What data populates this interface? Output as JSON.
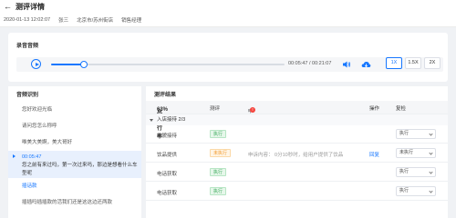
{
  "header": {
    "title": "测评详情"
  },
  "meta": {
    "datetime": "2020-01-13 12:02:07",
    "name": "张三",
    "location": "北京市/苏州街店",
    "role": "销售经理"
  },
  "audio": {
    "label": "录音音频",
    "current_time": "00:05:47",
    "separator": "/",
    "total_time": "00:21:07",
    "progress_fraction": 0.14,
    "speeds": [
      "1X",
      "1.5X",
      "2X"
    ],
    "active_speed": "1X"
  },
  "recognition": {
    "title": "音频识别",
    "items": [
      {
        "text": "您好欢迎光临",
        "active": false
      },
      {
        "text": "请问您怎么称呼",
        "active": false
      },
      {
        "text": "唯美大美婀，美大哥好",
        "active": false
      },
      {
        "timestamp": "00:05:47",
        "text": "您之前有来过吗，第一次过来吗，那边是想看什么车型呢",
        "active": true
      },
      {
        "text": "插话款",
        "active": false,
        "blue": true
      },
      {
        "text": "插插吗插插款的活我们还是这这边还两款",
        "active": false
      }
    ]
  },
  "results": {
    "title": "测评结果",
    "columns": {
      "rate_label": "总执行率",
      "rate_value": "63%",
      "review": "测评",
      "appeal": "申诉",
      "appeal_badge": "!",
      "op": "操作",
      "recheck": "复检"
    },
    "group": {
      "name": "入店接待",
      "progress": "2/3"
    },
    "rows": [
      {
        "item": "礼貌接待",
        "tag": "执行",
        "tag_color": "green",
        "appeal": "",
        "op": "",
        "select": "执行"
      },
      {
        "item": "饮品提供",
        "tag": "未执行",
        "tag_color": "orange",
        "appeal": "申诉内容：  0分10秒时，给用户提供了饮品",
        "op": "回复",
        "select": "未执行"
      },
      {
        "item": "电话获取",
        "tag": "执行",
        "tag_color": "green",
        "appeal": "",
        "op": "",
        "select": "执行"
      },
      {
        "item": "电话获取",
        "tag": "执行",
        "tag_color": "green",
        "appeal": "",
        "op": "",
        "select": "执行"
      }
    ]
  },
  "colors": {
    "accent": "#1677ff",
    "success": "#3aa85a",
    "warning": "#f29b2f",
    "danger": "#f5453e"
  }
}
